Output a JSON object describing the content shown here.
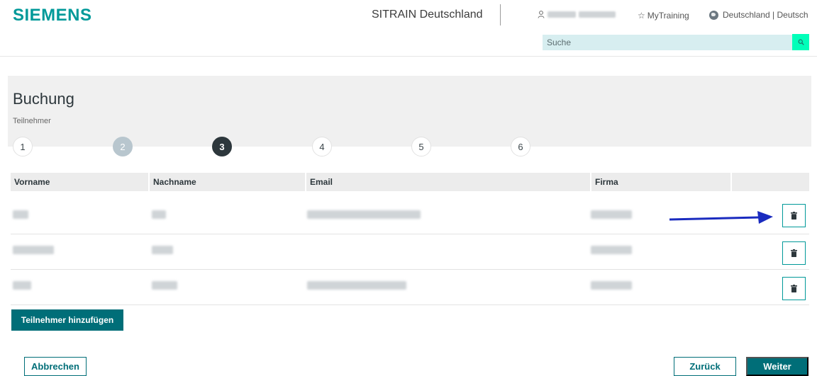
{
  "header": {
    "brand": "SIEMENS",
    "site_title": "SITRAIN Deutschland",
    "mytraining_label": "MyTraining",
    "language_label": "Deutschland | Deutsch",
    "search_placeholder": "Suche"
  },
  "booking": {
    "title": "Buchung",
    "step_label": "Teilnehmer",
    "steps": [
      "1",
      "2",
      "3",
      "4",
      "5",
      "6"
    ],
    "completed_step": "2",
    "active_step": "3"
  },
  "table": {
    "columns": [
      "Vorname",
      "Nachname",
      "Email",
      "Firma"
    ]
  },
  "actions": {
    "add_participant": "Teilnehmer hinzufügen",
    "cancel": "Abbrechen",
    "back": "Zurück",
    "next": "Weiter"
  },
  "colors": {
    "brand": "#009999",
    "primary_button": "#006e78",
    "search_button": "#00ffb9",
    "annotation_arrow": "#1a2bbf"
  },
  "icons": {
    "delete": "trash-icon",
    "search": "search-icon",
    "language": "globe-icon",
    "mytraining": "star-icon",
    "user": "user-icon"
  }
}
